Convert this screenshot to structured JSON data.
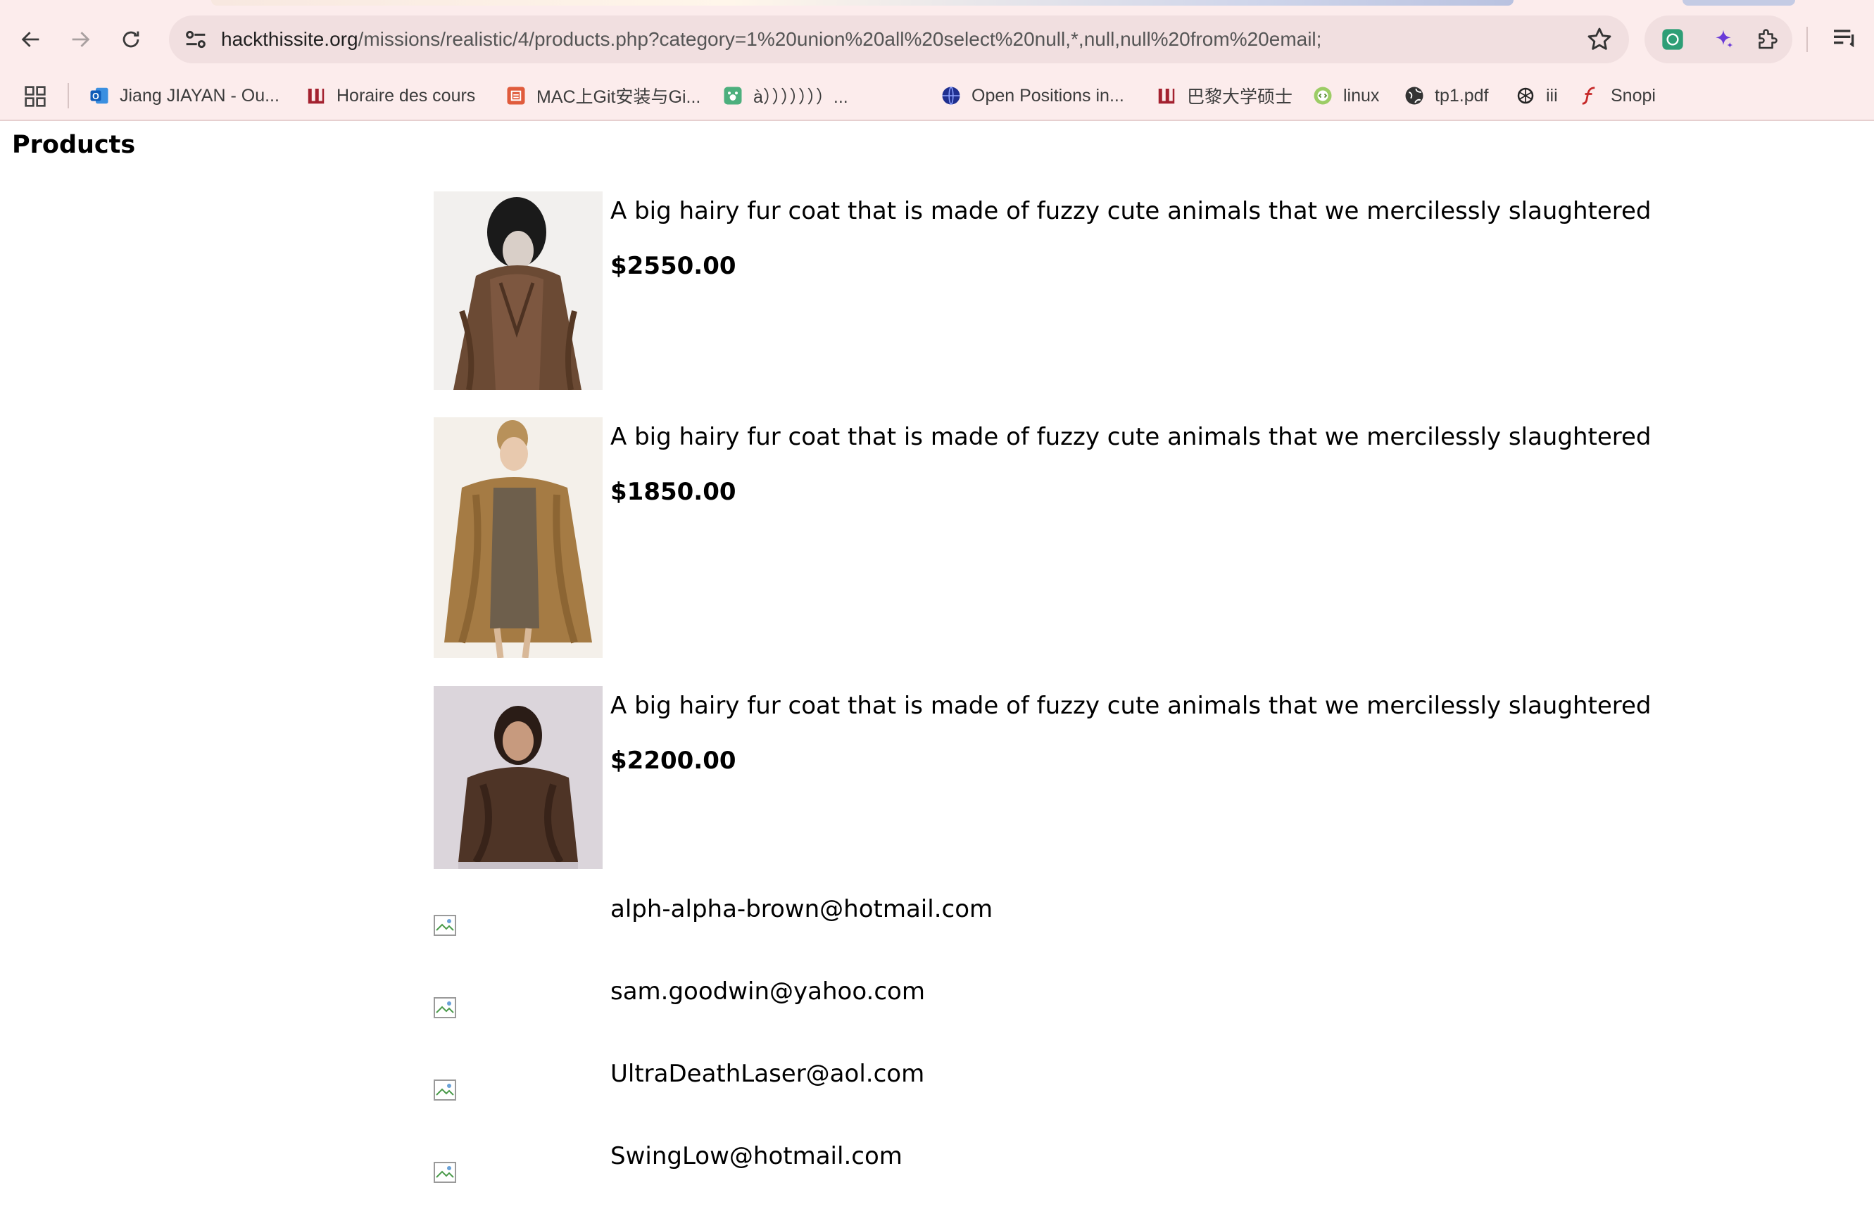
{
  "browser": {
    "url_host": "hackthissite.org",
    "url_path": "/missions/realistic/4/products.php?category=1%20union%20all%20select%20null,*,null,null%20from%20email;",
    "bookmarks": [
      {
        "label": "Jiang JIAYAN - Ou...",
        "icon": "outlook-icon",
        "color": "#1565c0"
      },
      {
        "label": "Horaire des cours",
        "icon": "university-logo-icon",
        "color": "#a3212f"
      },
      {
        "label": "MAC上Git安装与Gi...",
        "icon": "jianshu-icon",
        "color": "#e05b3c"
      },
      {
        "label": "à）））））））...",
        "icon": "paw-icon",
        "color": "#4caf7d"
      },
      {
        "label": "Open Positions in...",
        "icon": "globe-logo-icon",
        "color": "#1f2f8f"
      },
      {
        "label": "巴黎大学硕士",
        "icon": "university-logo-icon",
        "color": "#a3212f"
      },
      {
        "label": "linux",
        "icon": "code-badge-icon",
        "color": "#7cb342"
      },
      {
        "label": "tp1.pdf",
        "icon": "globe-icon",
        "color": "#333333"
      },
      {
        "label": "iii",
        "icon": "openai-icon",
        "color": "#222222"
      },
      {
        "label": "Snopi",
        "icon": "flash-icon",
        "color": "#c62828"
      }
    ]
  },
  "page": {
    "heading": "Products",
    "products": [
      {
        "description": "A big hairy fur coat that is made of fuzzy cute animals that we mercilessly slaughtered",
        "price": "$2550.00"
      },
      {
        "description": "A big hairy fur coat that is made of fuzzy cute animals that we mercilessly slaughtered",
        "price": "$1850.00"
      },
      {
        "description": "A big hairy fur coat that is made of fuzzy cute animals that we mercilessly slaughtered",
        "price": "$2200.00"
      }
    ],
    "emails": [
      "alph-alpha-brown@hotmail.com",
      "sam.goodwin@yahoo.com",
      "UltraDeathLaser@aol.com",
      "SwingLow@hotmail.com"
    ]
  }
}
